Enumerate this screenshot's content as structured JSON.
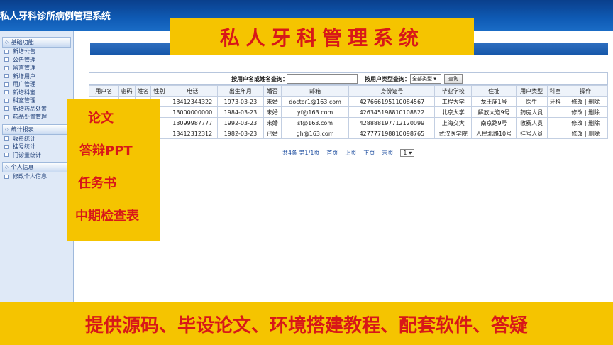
{
  "app": {
    "title": "私人牙科诊所病例管理系统"
  },
  "banner": {
    "text": "私人牙科管理系统"
  },
  "sidebar": {
    "groups": [
      {
        "title": "基础功能",
        "items": [
          "新增公告",
          "公告管理",
          "留言管理",
          "新增用户",
          "用户管理",
          "新增科室",
          "科室管理",
          "新增药品处置",
          "药品处置管理"
        ]
      },
      {
        "title": "统计报表",
        "items": [
          "收费统计",
          "挂号统计",
          "门诊量统计"
        ]
      },
      {
        "title": "个人信息",
        "items": [
          "修改个人信息"
        ]
      }
    ]
  },
  "search": {
    "name_label": "按用户名或姓名查询：",
    "name_value": "",
    "type_label": "按用户类型查询：",
    "type_value": "全部类型",
    "button": "查询"
  },
  "table": {
    "headers": [
      "用户名",
      "密码",
      "姓名",
      "性别",
      "电话",
      "出生年月",
      "婚否",
      "邮箱",
      "身份证号",
      "毕业学校",
      "住址",
      "用户类型",
      "科室",
      "操作"
    ],
    "rows": [
      [
        "",
        "",
        "",
        "",
        "13412344322",
        "1973-03-23",
        "未婚",
        "doctor1@163.com",
        "427666195110084567",
        "工程大学",
        "龙王庙1号",
        "医生",
        "牙科"
      ],
      [
        "",
        "",
        "",
        "",
        "13000000000",
        "1984-03-23",
        "未婚",
        "yf@163.com",
        "426345198810108822",
        "北京大学",
        "解放大道9号",
        "药房人员",
        ""
      ],
      [
        "",
        "",
        "",
        "",
        "13099987777",
        "1992-03-23",
        "未婚",
        "sf@163.com",
        "428888197712120099",
        "上海交大",
        "南京路9号",
        "收费人员",
        ""
      ],
      [
        "",
        "",
        "",
        "",
        "13412312312",
        "1982-03-23",
        "已婚",
        "gh@163.com",
        "427777198810098765",
        "武汉医学院",
        "人民北路10号",
        "挂号人员",
        ""
      ]
    ],
    "edit_label": "修改",
    "sep": "|",
    "delete_label": "删除"
  },
  "pager": {
    "summary": "共4条 第1/1页",
    "first": "首页",
    "prev": "上页",
    "next": "下页",
    "last": "末页",
    "page_select": "1"
  },
  "overlay": {
    "items": [
      "论文",
      "答辩PPT",
      "任务书",
      "中期检查表"
    ]
  },
  "footer": {
    "text": "提供源码、毕设论文、环境搭建教程、配套软件、答疑"
  }
}
